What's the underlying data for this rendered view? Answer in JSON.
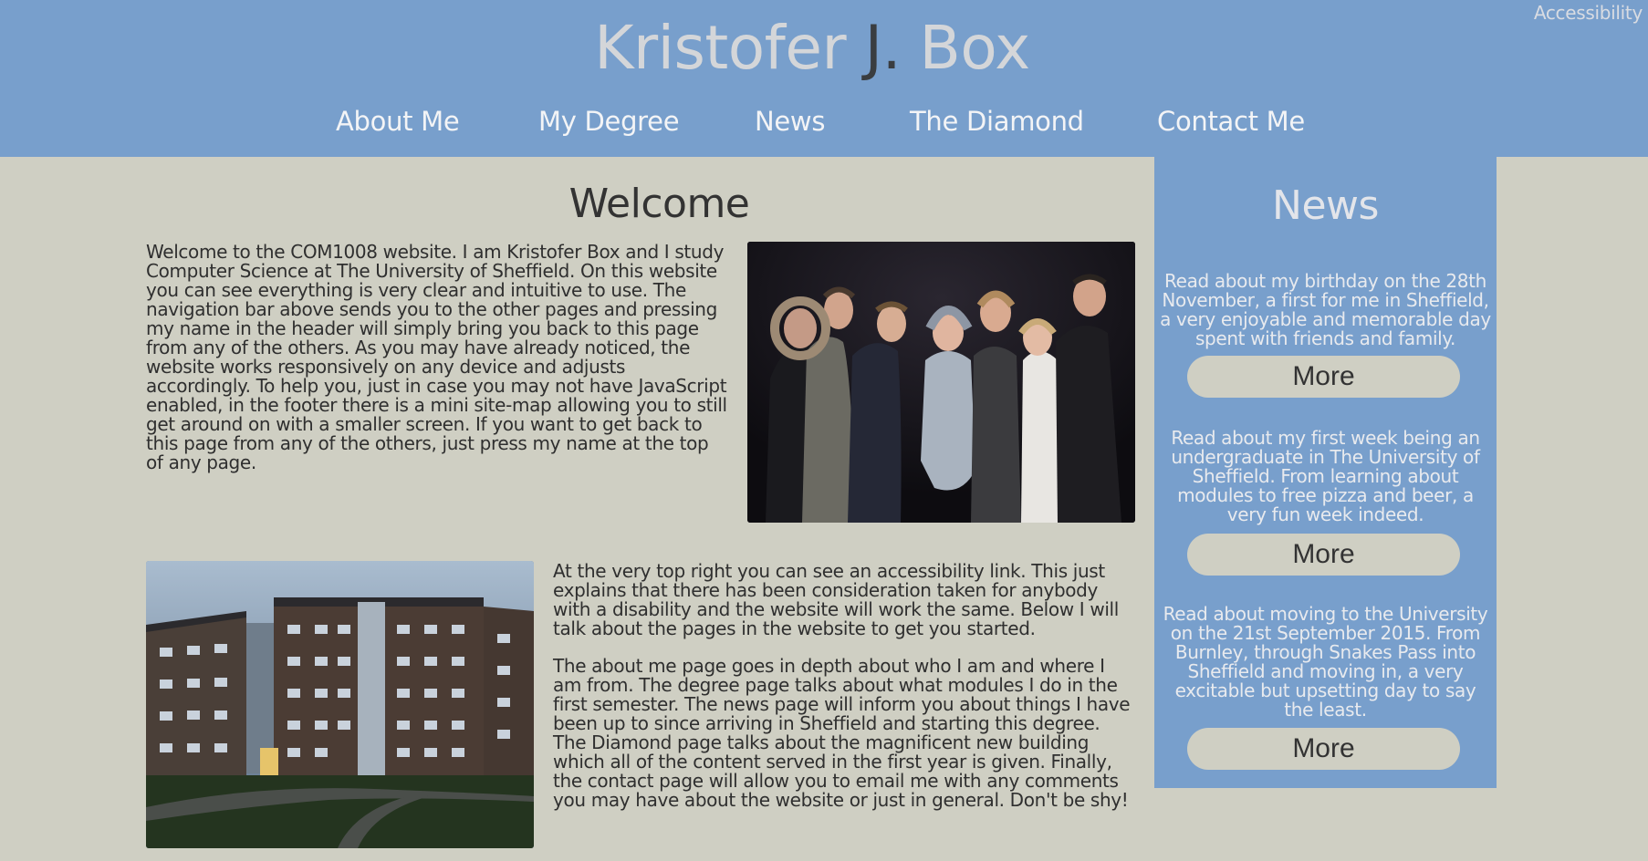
{
  "header": {
    "accessibility_link": "Accessibility",
    "title_part1": "Kristofer ",
    "title_part2": "J.",
    "title_part3": " Box",
    "nav": [
      {
        "label": "About Me"
      },
      {
        "label": "My Degree"
      },
      {
        "label": "News"
      },
      {
        "label": "The Diamond"
      },
      {
        "label": "Contact Me"
      }
    ]
  },
  "main": {
    "heading": "Welcome",
    "paragraphs": [
      "Welcome to the COM1008 website. I am Kristofer Box and I study Computer Science at The University of Sheffield. On this website you can see everything is very clear and intuitive to use. The navigation bar above sends you to the other pages and pressing my name in the header will simply bring you back to this page from any of the others. As you may have already noticed, the website works responsively on any device and adjusts accordingly. To help you, just in case you may not have JavaScript enabled, in the footer there is a mini site-map allowing you to still get around on with a smaller screen. If you want to get back to this page from any of the others, just press my name at the top of any page.",
      "At the very top right you can see an accessibility link. This just explains that there has been consideration taken for anybody with a disability and the website will work the same. Below I will talk about the pages in the website to get you started.",
      "The about me page goes in depth about who I am and where I am from. The degree page talks about what modules I do in the first semester. The news page will inform you about things I have been up to since arriving in Sheffield and starting this degree. The Diamond page talks about the magnificent new building which all of the content served in the first year is given. Finally, the contact page will allow you to email me with any comments you may have about the website or just in general. Don't be shy!"
    ]
  },
  "sidebar": {
    "heading": "News",
    "items": [
      {
        "text": "Read about my birthday on the 28th November, a first for me in Sheffield, a very enjoyable and memorable day spent with friends and family.",
        "button": "More"
      },
      {
        "text": "Read about my first week being an undergraduate in The University of Sheffield. From learning about modules to free pizza and beer, a very fun week indeed.",
        "button": "More"
      },
      {
        "text": "Read about moving to the University on the 21st September 2015. From Burnley, through Snakes Pass into Sheffield and moving in, a very excitable but upsetting day to say the least.",
        "button": "More"
      }
    ]
  },
  "colors": {
    "header_bg": "#789fcc",
    "page_bg": "#cfcfc3",
    "sidebar_bg": "#789fcc"
  }
}
